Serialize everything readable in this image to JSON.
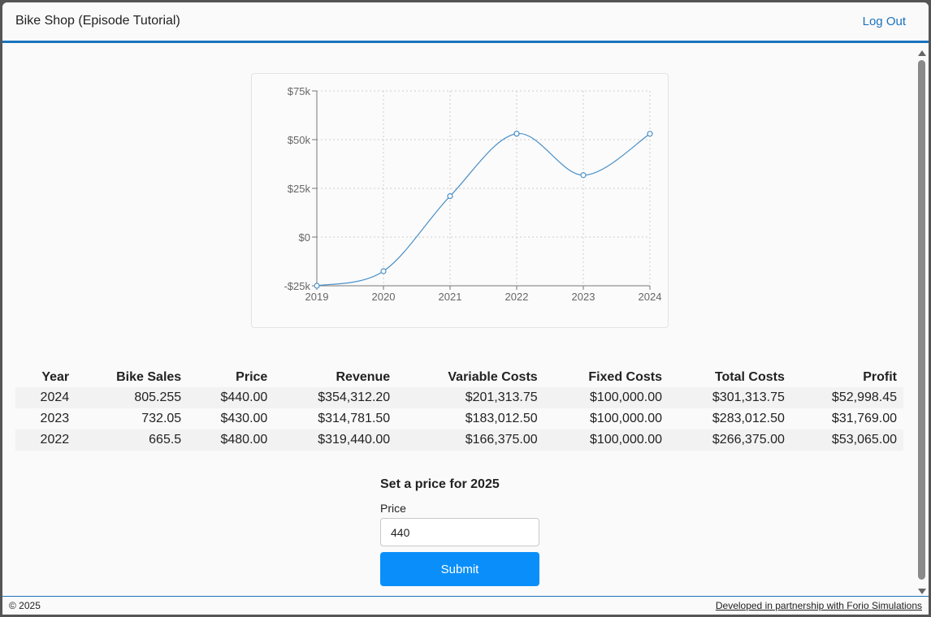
{
  "app": {
    "title": "Bike Shop (Episode Tutorial)",
    "logout_label": "Log Out"
  },
  "chart_data": {
    "type": "line",
    "x": [
      2019,
      2020,
      2021,
      2022,
      2023,
      2024
    ],
    "series": [
      {
        "values": [
          -25000,
          -17500,
          21000,
          53065,
          31769,
          52998
        ]
      }
    ],
    "ylim": [
      -25000,
      75000
    ],
    "yticks": [
      "$75k",
      "$50k",
      "$25k",
      "$0",
      "-$25k"
    ],
    "xticks": [
      "2019",
      "2020",
      "2021",
      "2022",
      "2023",
      "2024"
    ],
    "grid": true,
    "color": "#4a90c8"
  },
  "table": {
    "headers": [
      "Year",
      "Bike Sales",
      "Price",
      "Revenue",
      "Variable Costs",
      "Fixed Costs",
      "Total Costs",
      "Profit"
    ],
    "rows": [
      [
        "2024",
        "805.255",
        "$440.00",
        "$354,312.20",
        "$201,313.75",
        "$100,000.00",
        "$301,313.75",
        "$52,998.45"
      ],
      [
        "2023",
        "732.05",
        "$430.00",
        "$314,781.50",
        "$183,012.50",
        "$100,000.00",
        "$283,012.50",
        "$31,769.00"
      ],
      [
        "2022",
        "665.5",
        "$480.00",
        "$319,440.00",
        "$166,375.00",
        "$100,000.00",
        "$266,375.00",
        "$53,065.00"
      ]
    ]
  },
  "form": {
    "heading": "Set a price for 2025",
    "price_label": "Price",
    "price_value": "440",
    "submit_label": "Submit"
  },
  "footer": {
    "copyright": "© 2025",
    "partner_link": "Developed in partnership with Forio Simulations"
  },
  "colors": {
    "accent": "#1a73bd",
    "button": "#0a8ffa"
  }
}
